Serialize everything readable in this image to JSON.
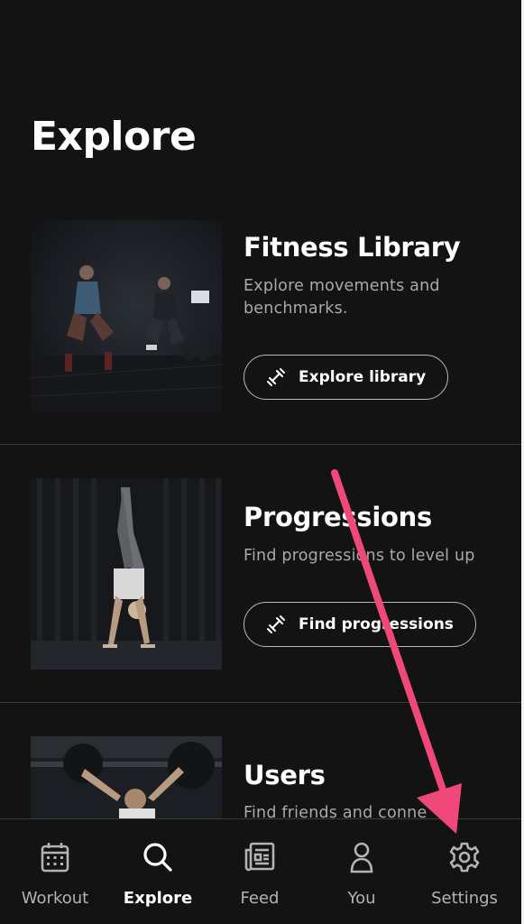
{
  "page": {
    "title": "Explore"
  },
  "cards": [
    {
      "title": "Fitness Library",
      "description": "Explore movements and benchmarks.",
      "button": "Explore library"
    },
    {
      "title": "Progressions",
      "description": "Find progressions to level up",
      "button": "Find progressions"
    },
    {
      "title": "Users",
      "description": "Find friends and conne"
    }
  ],
  "tabbar": {
    "items": [
      {
        "label": "Workout",
        "icon": "calendar-icon"
      },
      {
        "label": "Explore",
        "icon": "search-icon",
        "active": true
      },
      {
        "label": "Feed",
        "icon": "newspaper-icon"
      },
      {
        "label": "You",
        "icon": "person-icon"
      },
      {
        "label": "Settings",
        "icon": "gear-icon"
      }
    ]
  },
  "colors": {
    "background": "#131313",
    "divider": "#3a3a3a",
    "muted_text": "#a9a9a9",
    "annotation_arrow": "#f0487a"
  }
}
